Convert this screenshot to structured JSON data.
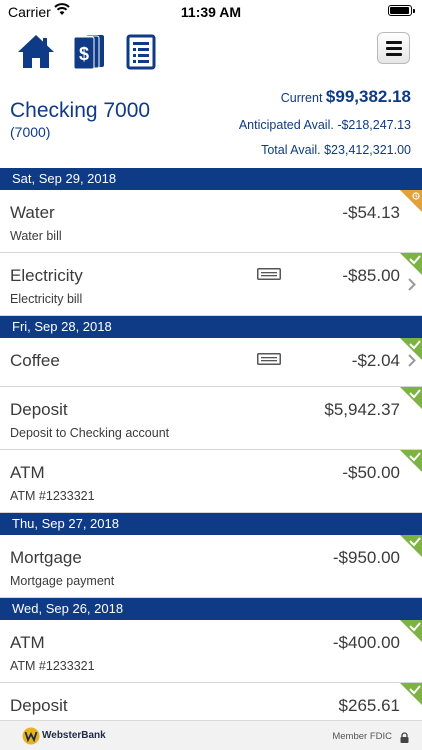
{
  "status_bar": {
    "carrier": "Carrier",
    "time": "11:39 AM"
  },
  "header": {
    "account_name": "Checking 7000",
    "account_number": "(7000)",
    "current_label": "Current",
    "current_value": "$99,382.18",
    "anticipated_label": "Anticipated Avail.",
    "anticipated_value": "-$218,247.13",
    "total_label": "Total Avail.",
    "total_value": "$23,412,321.00"
  },
  "dates": [
    "Sat, Sep 29, 2018",
    "Fri, Sep 28, 2018",
    "Thu, Sep 27, 2018",
    "Wed, Sep 26, 2018"
  ],
  "transactions": [
    {
      "desc": "Water",
      "sub": "Water bill",
      "amount": "-$54.13",
      "status": "pending"
    },
    {
      "desc": "Electricity",
      "sub": "Electricity bill",
      "amount": "-$85.00",
      "status": "cleared"
    },
    {
      "desc": "Coffee",
      "sub": "",
      "amount": "-$2.04",
      "status": "cleared"
    },
    {
      "desc": "Deposit",
      "sub": "Deposit to Checking account",
      "amount": "$5,942.37",
      "status": "cleared"
    },
    {
      "desc": "ATM",
      "sub": "ATM #1233321",
      "amount": "-$50.00",
      "status": "cleared"
    },
    {
      "desc": "Mortgage",
      "sub": "Mortgage payment",
      "amount": "-$950.00",
      "status": "cleared"
    },
    {
      "desc": "ATM",
      "sub": "ATM #1233321",
      "amount": "-$400.00",
      "status": "cleared"
    },
    {
      "desc": "Deposit",
      "sub": "",
      "amount": "$265.61",
      "status": "cleared"
    }
  ],
  "footer": {
    "brand": "WebsterBank",
    "fdic": "Member FDIC"
  },
  "colors": {
    "brand_blue": "#0f3a86",
    "cleared_green": "#7cb342",
    "pending_orange": "#e3a13b"
  },
  "icons": [
    "wifi-icon",
    "home-icon",
    "deposit-icon",
    "statement-icon",
    "hamburger-icon",
    "memo-icon",
    "chevron-right-icon",
    "check-icon",
    "clock-icon",
    "webster-logo-icon",
    "lock-icon"
  ]
}
